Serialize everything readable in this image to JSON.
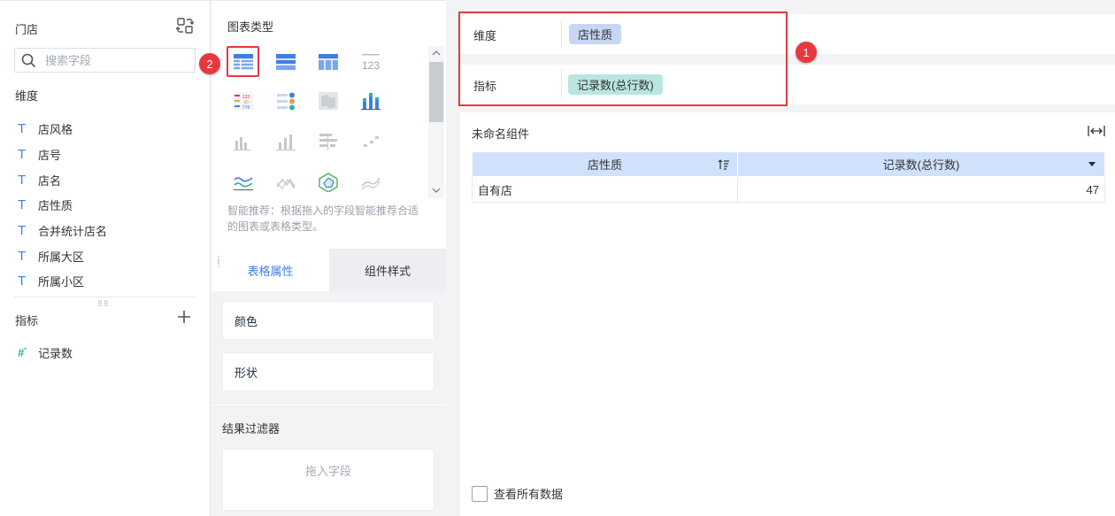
{
  "dataset": {
    "title": "门店",
    "search_placeholder": "搜索字段",
    "dimension_section": "维度",
    "dimensions": [
      "店风格",
      "店号",
      "店名",
      "店性质",
      "合并统计店名",
      "所属大区",
      "所属小区"
    ],
    "measure_section": "指标",
    "measures": [
      "记录数"
    ],
    "text_type_icon": "T",
    "measure_type_icon": "#"
  },
  "config": {
    "chart_type_title": "图表类型",
    "chart_types": [
      "table",
      "cross-table",
      "grouped-table",
      "kpi-number",
      "heat-table",
      "colored-kpi",
      "map",
      "stacked-bar",
      "bar",
      "column",
      "horizontal-bar",
      "scatter-step",
      "line",
      "area-line",
      "radar",
      "multi-line"
    ],
    "selected_chart_type": "table",
    "hint": "智能推荐：根据拖入的字段智能推荐合适的图表或表格类型。",
    "tabs": [
      "表格属性",
      "组件样式"
    ],
    "active_tab": "表格属性",
    "props": [
      "颜色",
      "形状"
    ],
    "filter_title": "结果过滤器",
    "filter_placeholder": "拖入字段"
  },
  "canvas": {
    "dimension_label": "维度",
    "dimension_pill": "店性质",
    "measure_label": "指标",
    "measure_pill": "记录数(总行数)",
    "widget_title": "未命名组件",
    "table": {
      "headers": [
        "店性质",
        "记录数(总行数)"
      ],
      "rows": [
        [
          "自有店",
          "47"
        ]
      ]
    },
    "view_all_label": "查看所有数据",
    "annotations": [
      "1",
      "2"
    ]
  },
  "colors": {
    "accent": "#3f7fe3",
    "dimension_pill": "#c7d6f4",
    "measure_pill": "#b9e6e0",
    "header": "#cfe1fb",
    "highlight": "#e5393d"
  }
}
